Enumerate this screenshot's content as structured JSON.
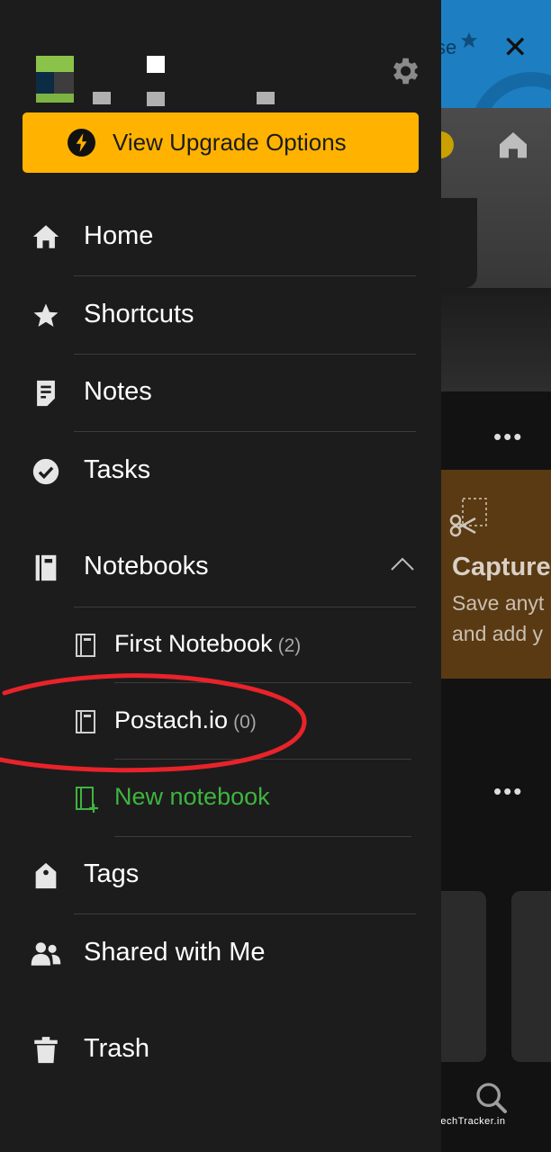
{
  "background": {
    "banner_text": "se",
    "dots": "•••",
    "capture_title": "Capture",
    "capture_lines": [
      "Save anyt",
      "and add y"
    ],
    "watermark": "TechTracker.in"
  },
  "drawer": {
    "upgrade_label": "View Upgrade Options",
    "items": [
      {
        "label": "Home",
        "icon": "home-icon"
      },
      {
        "label": "Shortcuts",
        "icon": "star-icon"
      },
      {
        "label": "Notes",
        "icon": "notes-icon"
      },
      {
        "label": "Tasks",
        "icon": "check-circle-icon"
      }
    ],
    "notebooks": {
      "label": "Notebooks",
      "expanded": true,
      "list": [
        {
          "label": "First Notebook",
          "count": "(2)"
        },
        {
          "label": "Postach.io",
          "count": "(0)"
        }
      ],
      "new_label": "New notebook"
    },
    "tags_label": "Tags",
    "shared_label": "Shared with Me",
    "trash_label": "Trash"
  },
  "colors": {
    "drawer_bg": "#1c1c1c",
    "accent_upgrade": "#ffb300",
    "accent_green": "#3fb43f",
    "annotation_red": "#e8232a"
  }
}
